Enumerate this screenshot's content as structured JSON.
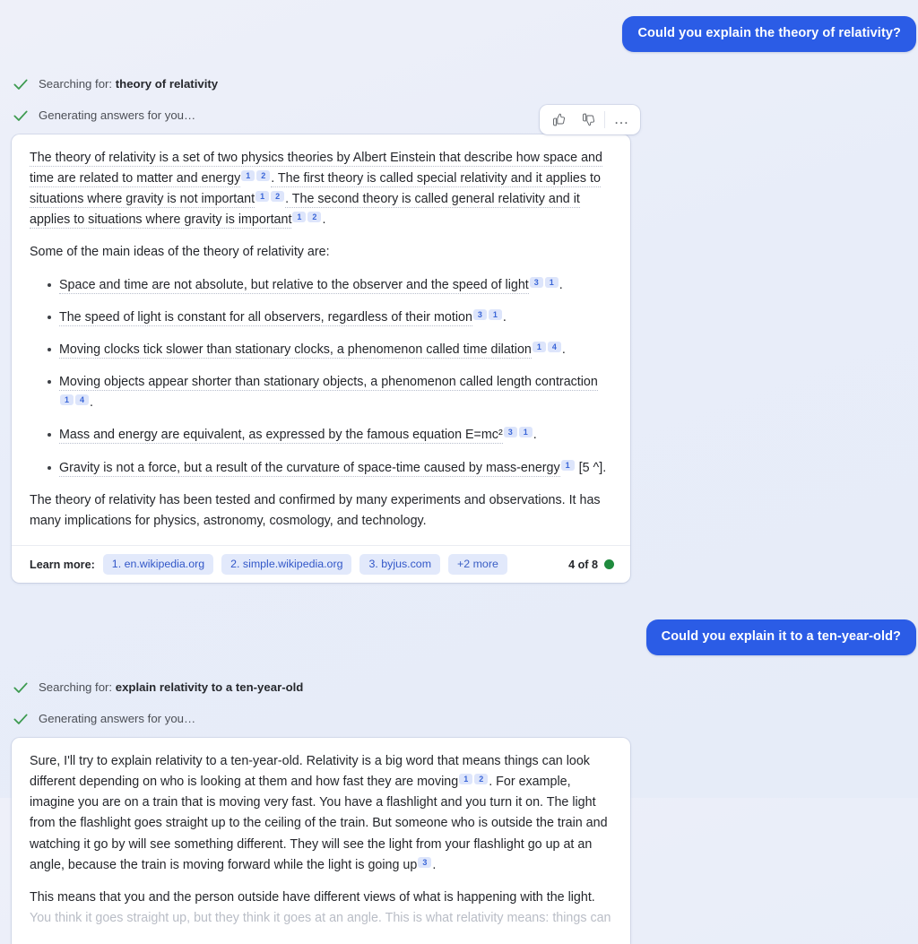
{
  "theme": {
    "background": "#e9edf8",
    "user_bubble": "#2b5ce6",
    "card": "#ffffff",
    "citation_chip": "#dde5fb",
    "citation_text": "#3a66d8",
    "source_chip": "#e2e9fb",
    "source_chip_text": "#3257c8",
    "check_green": "#3c9a4f",
    "status_dot_green": "#1f8b3e"
  },
  "turns": [
    {
      "user_message": "Could you explain the theory of relativity?",
      "status": [
        {
          "icon": "check-icon",
          "prefix": "Searching for: ",
          "query": "theory of relativity"
        },
        {
          "icon": "check-icon",
          "prefix": "Generating answers for you…",
          "query": ""
        }
      ],
      "feedback": {
        "thumbs_up": "thumb-up-icon",
        "thumbs_down": "thumb-down-icon",
        "more": "…"
      },
      "answer": {
        "paragraph_1_a": "The theory of relativity is a set of two physics theories by Albert Einstein that describe how space and time are related to matter and energy",
        "paragraph_1_b": ". The first theory is called special relativity and it applies to situations where gravity is not important",
        "paragraph_1_c": ". The second theory is called general relativity and it applies to situations where gravity is important",
        "paragraph_1_d": ".",
        "paragraph_2": "Some of the main ideas of the theory of relativity are:",
        "bullets": [
          {
            "text": "Space and time are not absolute, but relative to the observer and the speed of light",
            "cites": [
              "3",
              "1"
            ],
            "tail": "."
          },
          {
            "text": "The speed of light is constant for all observers, regardless of their motion",
            "cites": [
              "3",
              "1"
            ],
            "tail": "."
          },
          {
            "text": "Moving clocks tick slower than stationary clocks, a phenomenon called time dilation",
            "cites": [
              "1",
              "4"
            ],
            "tail": "."
          },
          {
            "text": "Moving objects appear shorter than stationary objects, a phenomenon called length contraction",
            "cites": [
              "1",
              "4"
            ],
            "tail": "."
          },
          {
            "text": "Mass and energy are equivalent, as expressed by the famous equation E=mc²",
            "cites": [
              "3",
              "1"
            ],
            "tail": "."
          },
          {
            "text": "Gravity is not a force, but a result of the curvature of space-time caused by mass-energy",
            "cites": [
              "1"
            ],
            "tail": "[5 ^]."
          }
        ],
        "closing": "The theory of relativity has been tested and confirmed by many experiments and observations. It has many implications for physics, astronomy, cosmology, and technology."
      },
      "footer": {
        "learn_more_label": "Learn more:",
        "sources": [
          "1. en.wikipedia.org",
          "2. simple.wikipedia.org",
          "3. byjus.com"
        ],
        "more_label": "+2 more",
        "counter": "4 of 8"
      }
    },
    {
      "user_message": "Could you explain it to a ten-year-old?",
      "status": [
        {
          "icon": "check-icon",
          "prefix": "Searching for: ",
          "query": "explain relativity to a ten-year-old"
        },
        {
          "icon": "check-icon",
          "prefix": "Generating answers for you…",
          "query": ""
        }
      ],
      "answer": {
        "paragraph_1_a": "Sure, I'll try to explain relativity to a ten-year-old. Relativity is a big word that means things can look different depending on who is looking at them and how fast they are moving",
        "paragraph_1_b": ". For example, imagine you are on a train that is moving very fast. You have a flashlight and you turn it on. The light from the flashlight goes straight up to the ceiling of the train. But someone who is outside the train and watching it go by will see something different. They will see the light from your flashlight go up at an angle, because the train is moving forward while the light is going up",
        "paragraph_1_c": ".",
        "paragraph_2_a": "This means that you and the person outside have different views of what is happening with the light.",
        "paragraph_2_b": " You think it goes straight up, but they think it goes at an angle. This is what relativity means: things can"
      }
    }
  ]
}
